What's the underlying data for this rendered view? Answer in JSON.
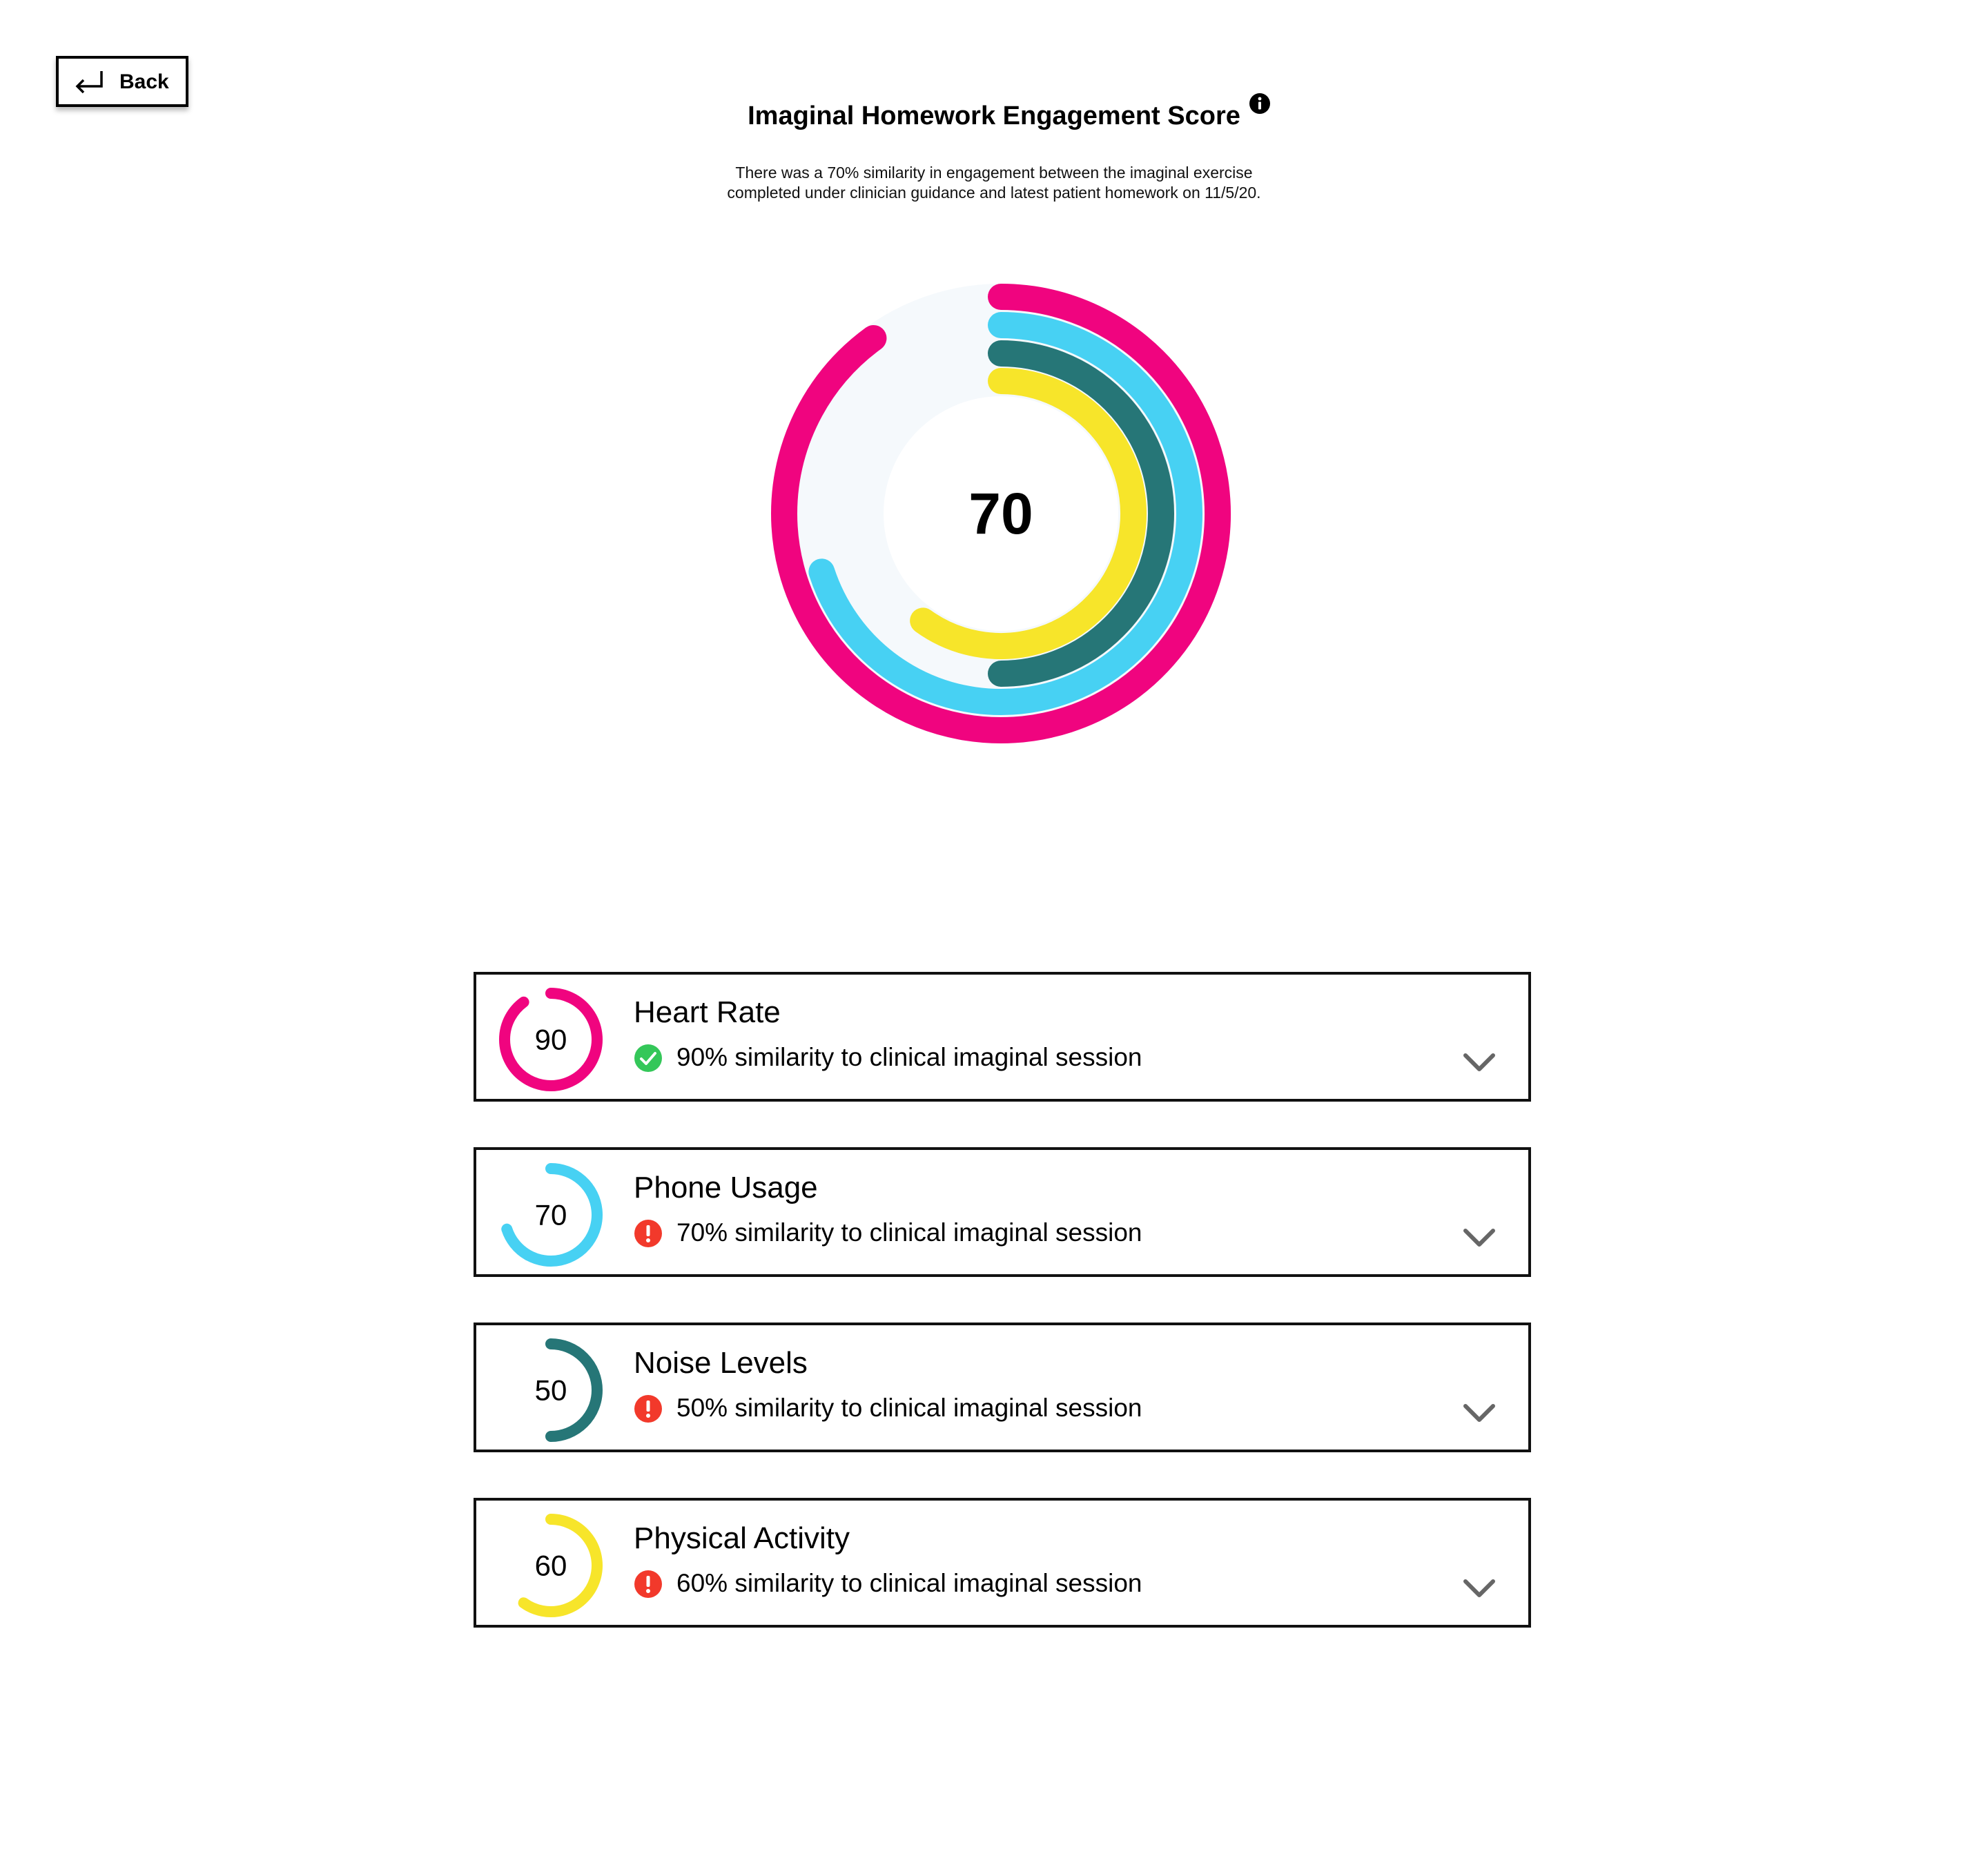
{
  "nav": {
    "back_label": "Back"
  },
  "header": {
    "title": "Imaginal Homework Engagement Score",
    "subtitle": "There was a 70% similarity in engagement between the imaginal exercise completed under clinician guidance and latest patient homework on 11/5/20."
  },
  "chart_data": {
    "type": "radial_progress",
    "center_value": "70",
    "series": [
      {
        "name": "Heart Rate",
        "value": 90,
        "color": "#F0047F"
      },
      {
        "name": "Phone Usage",
        "value": 70,
        "color": "#47D1F3"
      },
      {
        "name": "Noise Levels",
        "value": 50,
        "color": "#267677"
      },
      {
        "name": "Physical Activity",
        "value": 60,
        "color": "#F7E52A"
      }
    ],
    "max": 100
  },
  "metrics": [
    {
      "value": 90,
      "value_label": "90",
      "title": "Heart Rate",
      "description": "90% similarity to clinical imaginal session",
      "status": "ok",
      "color": "#F0047F"
    },
    {
      "value": 70,
      "value_label": "70",
      "title": "Phone Usage",
      "description": "70% similarity to clinical imaginal session",
      "status": "alert",
      "color": "#47D1F3"
    },
    {
      "value": 50,
      "value_label": "50",
      "title": "Noise Levels",
      "description": "50% similarity to clinical imaginal session",
      "status": "alert",
      "color": "#267677"
    },
    {
      "value": 60,
      "value_label": "60",
      "title": "Physical Activity",
      "description": "60% similarity to clinical imaginal session",
      "status": "alert",
      "color": "#F7E52A"
    }
  ],
  "colors": {
    "ok": "#34C759",
    "alert": "#F2392B",
    "chevron": "#666666",
    "track": "#F5F9FC"
  }
}
